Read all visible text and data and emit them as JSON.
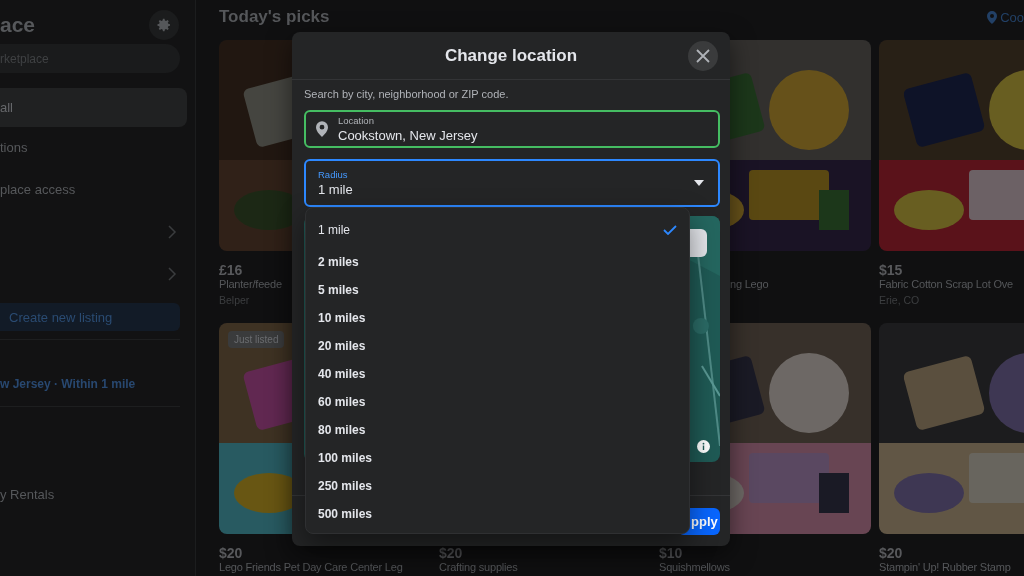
{
  "sidebar": {
    "title": "ace",
    "search_placeholder": "rketplace",
    "nav": [
      {
        "label": "all",
        "selected": true
      },
      {
        "label": "tions",
        "selected": false
      },
      {
        "label": "place access",
        "selected": false
      }
    ],
    "sections": [
      {
        "expanded": false
      },
      {
        "expanded": false
      }
    ],
    "create_button": "Create new listing",
    "location_filter": "w Jersey · Within 1 mile",
    "categories": [
      "y Rentals"
    ]
  },
  "main": {
    "heading": "Today's picks",
    "location": "Coo",
    "listings": [
      {
        "kind": "listing",
        "price": "£16",
        "title": "Planter/feede",
        "location": "Belper"
      },
      {
        "kind": "covered"
      },
      {
        "kind": "listing",
        "title": "ng Lego"
      },
      {
        "kind": "listing",
        "price": "$15",
        "title": "Fabric Cotton Scrap Lot Ove",
        "location": "Erie, CO"
      },
      {
        "kind": "listing",
        "badge": "Just listed",
        "price": "$20",
        "title": "Lego Friends Pet Day Care Center Leg"
      },
      {
        "kind": "caption",
        "price": "$20",
        "title": "Crafting supplies"
      },
      {
        "kind": "listing",
        "price": "$10",
        "title": "Squishmellows"
      },
      {
        "kind": "listing",
        "price": "$20",
        "title": "Stampin' Up! Rubber Stamp"
      }
    ]
  },
  "dialog": {
    "title": "Change location",
    "hint": "Search by city, neighborhood or ZIP code.",
    "location": {
      "label": "Location",
      "value": "Cookstown, New Jersey"
    },
    "radius": {
      "label": "Radius",
      "value": "1 mile",
      "expanded": true
    },
    "options": [
      {
        "label": "1 mile",
        "selected": true
      },
      {
        "label": "2 miles",
        "selected": false
      },
      {
        "label": "5 miles",
        "selected": false
      },
      {
        "label": "10 miles",
        "selected": false
      },
      {
        "label": "20 miles",
        "selected": false
      },
      {
        "label": "40 miles",
        "selected": false
      },
      {
        "label": "60 miles",
        "selected": false
      },
      {
        "label": "80 miles",
        "selected": false
      },
      {
        "label": "100 miles",
        "selected": false
      },
      {
        "label": "250 miles",
        "selected": false
      },
      {
        "label": "500 miles",
        "selected": false
      }
    ],
    "apply_button": "pply"
  }
}
